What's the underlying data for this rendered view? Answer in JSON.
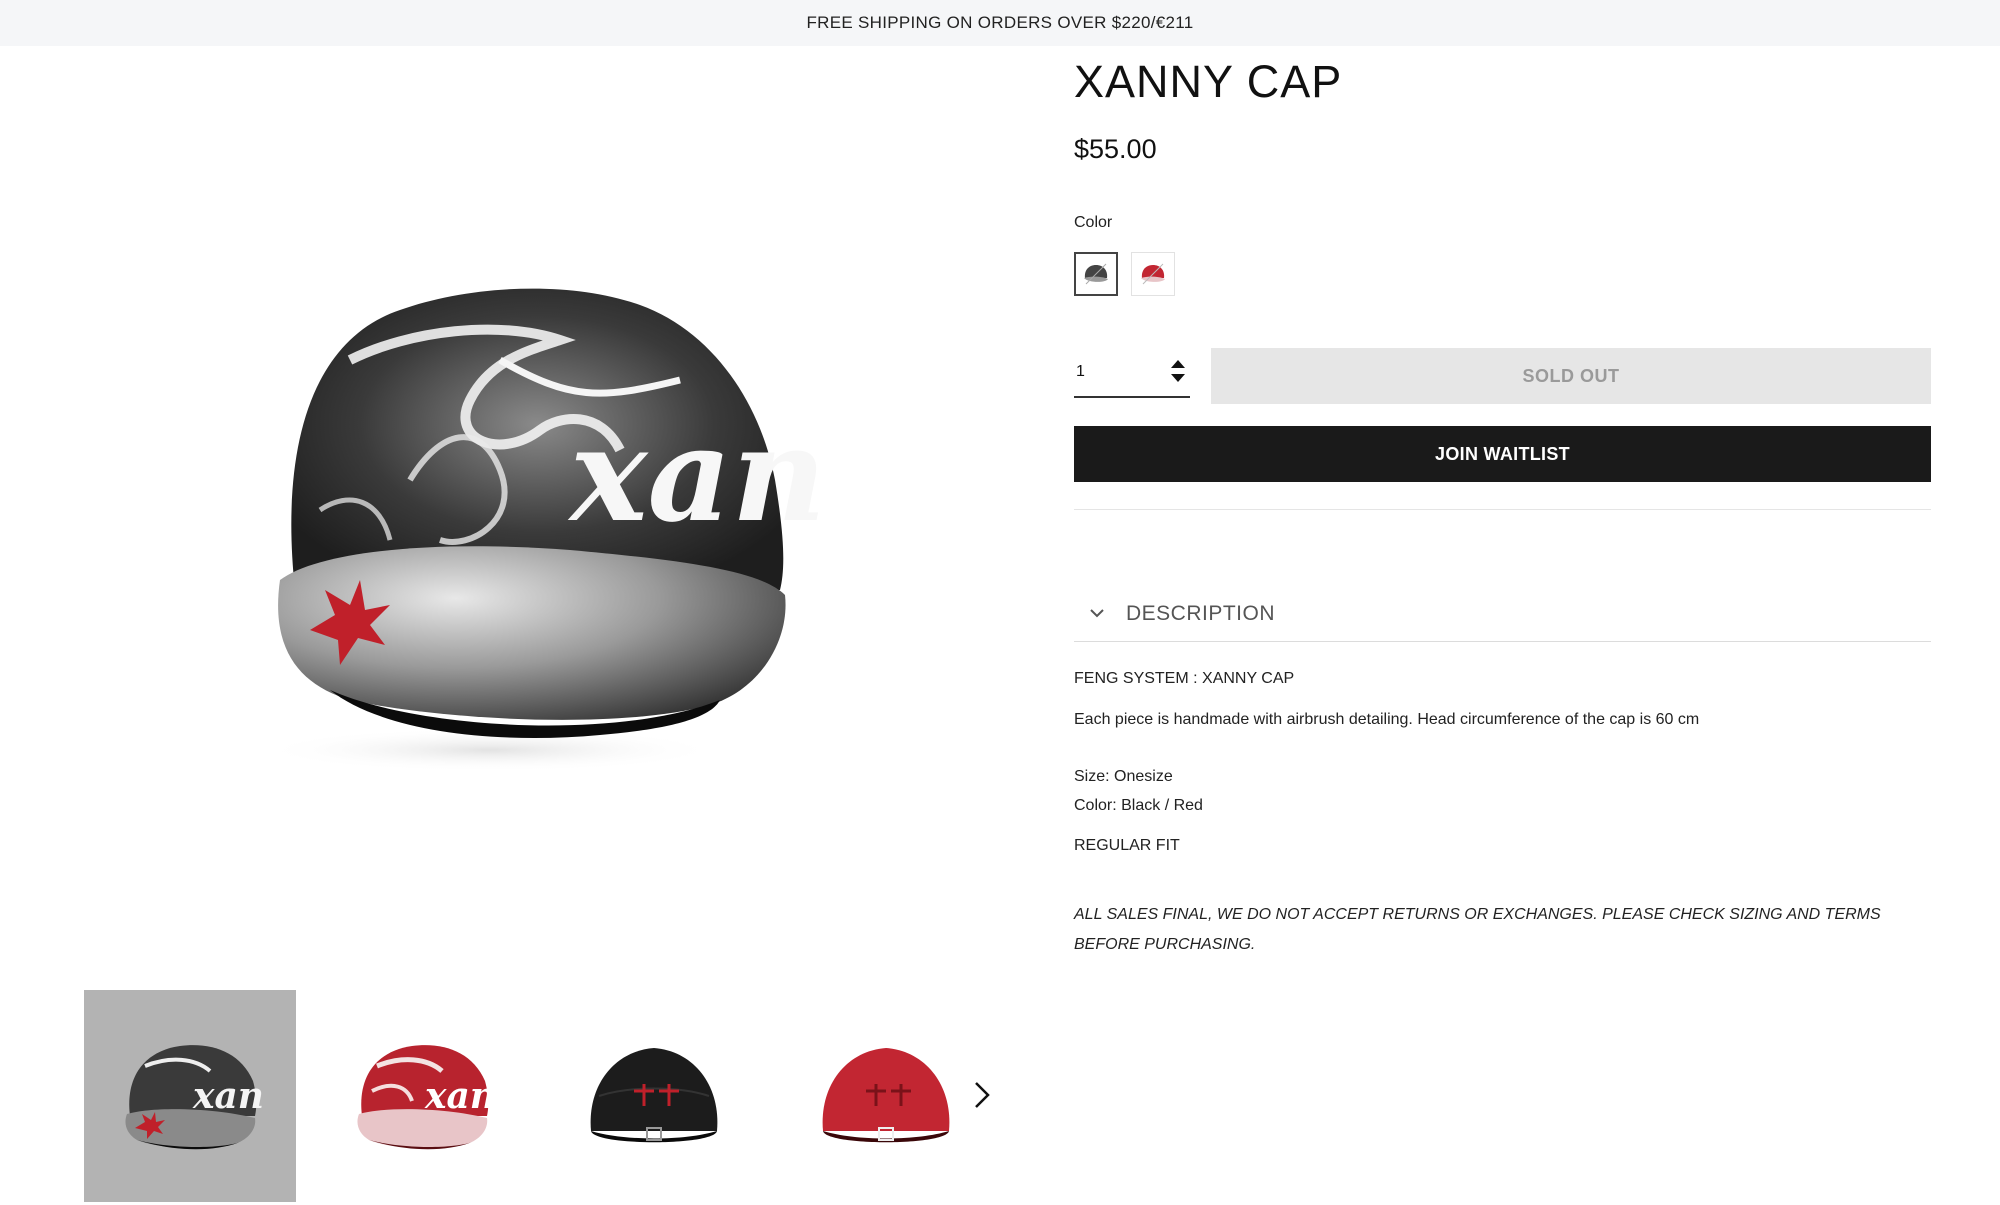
{
  "announcement": "FREE SHIPPING ON ORDERS OVER $220/€211",
  "product": {
    "title": "XANNY CAP",
    "price": "$55.00",
    "color_label": "Color",
    "swatches": [
      "black-red",
      "red"
    ],
    "selected_swatch": 0,
    "quantity": "1",
    "sold_out_label": "SOLD OUT",
    "waitlist_label": "JOIN WAITLIST"
  },
  "description": {
    "header": "DESCRIPTION",
    "lines": [
      "FENG SYSTEM :  XANNY CAP",
      "Each piece is handmade with airbrush detailing. Head circumference of the cap is 60 cm",
      "Size: Onesize",
      "Color: Black / Red",
      "REGULAR FIT"
    ],
    "note": "ALL SALES FINAL, WE DO NOT ACCEPT RETURNS OR EXCHANGES. PLEASE CHECK SIZING AND TERMS BEFORE PURCHASING."
  },
  "gallery": {
    "images": [
      "cap-black-front",
      "cap-red-front",
      "cap-black-back",
      "cap-red-back"
    ],
    "active_index": 0
  },
  "colors": {
    "announcement_bg": "#f5f6f8",
    "button_dark": "#1a1a1a",
    "sold_out_bg": "#e6e6e6",
    "accent_red": "#c0202a"
  }
}
